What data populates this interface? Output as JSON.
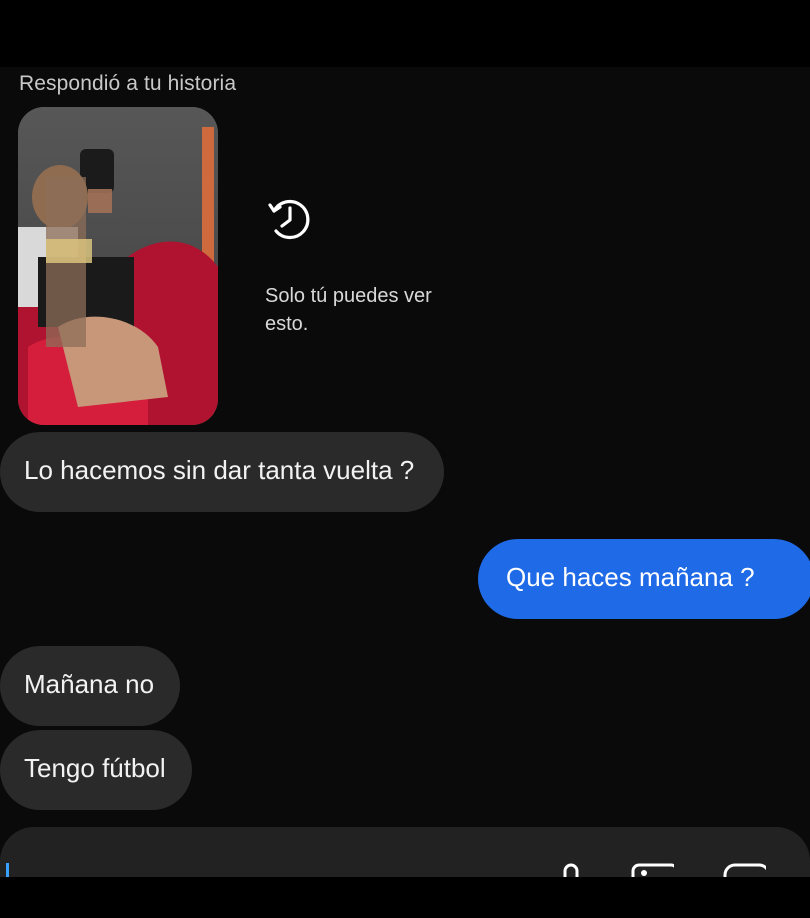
{
  "chat": {
    "reply_caption": "Respondió a tu historia",
    "story": {
      "note": "Solo tú puedes ver esto.",
      "icon": "history-icon"
    },
    "messages": [
      {
        "side": "incoming",
        "text": "Lo hacemos sin dar tanta vuelta ?"
      },
      {
        "side": "outgoing",
        "text": "Que haces mañana ?"
      },
      {
        "side": "incoming",
        "text": "Mañana no"
      },
      {
        "side": "incoming",
        "text": "Tengo fútbol"
      }
    ]
  },
  "composer": {
    "icons": [
      "microphone-icon",
      "gallery-icon",
      "sticker-icon"
    ]
  },
  "colors": {
    "outgoing_bubble": "#1f6ae6",
    "incoming_bubble": "#2a2a2a",
    "background": "#0a0a0a"
  }
}
